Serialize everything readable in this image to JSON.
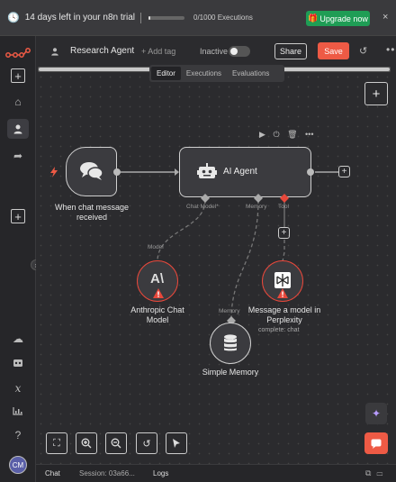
{
  "banner": {
    "trial_text": "14 days left in your n8n trial",
    "executions_text": "0/1000 Executions",
    "executions_used": 0,
    "executions_limit": 1000,
    "upgrade_label": "Upgrade now",
    "close_symbol": "×"
  },
  "header": {
    "workflow_name": "Research Agent",
    "add_tag_label": "+ Add tag",
    "status_label": "Inactive",
    "share_label": "Share",
    "save_label": "Save",
    "more_symbol": "•••"
  },
  "tabs": [
    {
      "label": "Editor",
      "active": true
    },
    {
      "label": "Executions",
      "active": false
    },
    {
      "label": "Evaluations",
      "active": false
    }
  ],
  "nodes": {
    "chat_trigger": {
      "label": "When chat message received"
    },
    "ai_agent": {
      "label": "AI Agent",
      "ports": {
        "chat_model": "Chat Model*",
        "memory": "Memory",
        "tool": "Tool"
      }
    },
    "anthropic": {
      "label": "Anthropic Chat Model",
      "port": "Model"
    },
    "memory": {
      "label": "Simple Memory",
      "port": "Memory"
    },
    "perplexity": {
      "label": "Message a model in Perplexity",
      "sublabel": "complete: chat"
    }
  },
  "bottom": {
    "chat_label": "Chat",
    "session_label": "Session: 03a66...",
    "logs_label": "Logs"
  },
  "user": {
    "initials": "CM"
  },
  "colors": {
    "accent": "#ee5a45",
    "upgrade": "#1f9d55",
    "error": "#e8483b",
    "warning": "#e8483b"
  }
}
